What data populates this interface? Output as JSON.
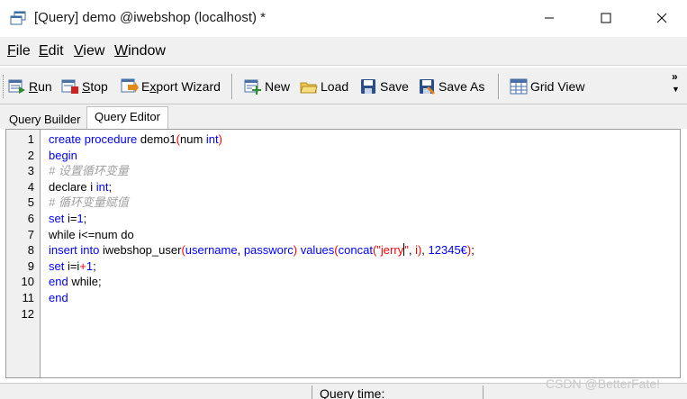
{
  "window": {
    "title": "[Query] demo @iwebshop (localhost) *",
    "min_icon": "minimize-icon",
    "max_icon": "maximize-icon",
    "close_icon": "close-icon"
  },
  "menu": [
    {
      "label": "File",
      "accel": "F",
      "rest": "ile"
    },
    {
      "label": "Edit",
      "accel": "E",
      "rest": "dit"
    },
    {
      "label": "View",
      "accel": "V",
      "rest": "iew"
    },
    {
      "label": "Window",
      "accel": "W",
      "rest": "indow"
    }
  ],
  "toolbar": {
    "run": {
      "label": "Run",
      "accel": "R",
      "rest": "un",
      "icon": "run-icon"
    },
    "stop": {
      "label": "Stop",
      "accel": "S",
      "rest": "top",
      "icon": "stop-icon"
    },
    "export": {
      "label": "Export Wizard",
      "pre": "E",
      "accel": "x",
      "rest": "port Wizard",
      "icon": "export-wizard-icon"
    },
    "new": {
      "label": "New",
      "icon": "new-icon"
    },
    "load": {
      "label": "Load",
      "icon": "load-icon"
    },
    "save": {
      "label": "Save",
      "icon": "save-icon"
    },
    "save_as": {
      "label": "Save As",
      "icon": "save-as-icon"
    },
    "grid_view": {
      "label": "Grid View",
      "icon": "grid-view-icon"
    },
    "overflow": "»"
  },
  "tabs": {
    "builder": "Query Builder",
    "editor": "Query Editor"
  },
  "editor": {
    "line_numbers": [
      "1",
      "2",
      "3",
      "4",
      "5",
      "6",
      "7",
      "8",
      "9",
      "10",
      "11",
      "12"
    ],
    "lines": {
      "l1": {
        "kw1": "create procedure",
        "id": " demo1",
        "p1": "(",
        "arg": "num ",
        "kw2": "int",
        "p2": ")"
      },
      "l2": {
        "kw": "begin"
      },
      "l3": {
        "comment": "# 设置循环变量"
      },
      "l4": {
        "id": "declare i ",
        "kw": "int",
        "end": ";"
      },
      "l5": {
        "comment": "# 循环变量赋值"
      },
      "l6": {
        "kw": "set",
        "id": " i=",
        "num": "1",
        "end": ";"
      },
      "l7": {
        "text": "while i<=num do"
      },
      "l8": {
        "kw1": "insert into",
        "id": " iwebshop_user",
        "p1": "(",
        "c1": "username",
        "sep": ", ",
        "c2": "passworc",
        "p2": ")",
        "kw2": " values",
        "p3": "(",
        "fn": "concat",
        "p4": "(",
        "s1": "\"jerry",
        "s2": "\"",
        "mid": ", ",
        "i": "i",
        "p5": ")",
        "mid2": ", ",
        "num": "12345€",
        "p6": ")",
        "end": ";"
      },
      "l9": {
        "kw": "set",
        "id": " i=i",
        "op": "+",
        "num": "1",
        "end": ";"
      },
      "l10": {
        "kw": "end",
        "id": " while;"
      },
      "l11": {
        "kw": "end"
      },
      "l12": {
        "text": ""
      }
    }
  },
  "status": {
    "query_time": "Query time:"
  },
  "watermark": "CSDN @BetterFate!"
}
